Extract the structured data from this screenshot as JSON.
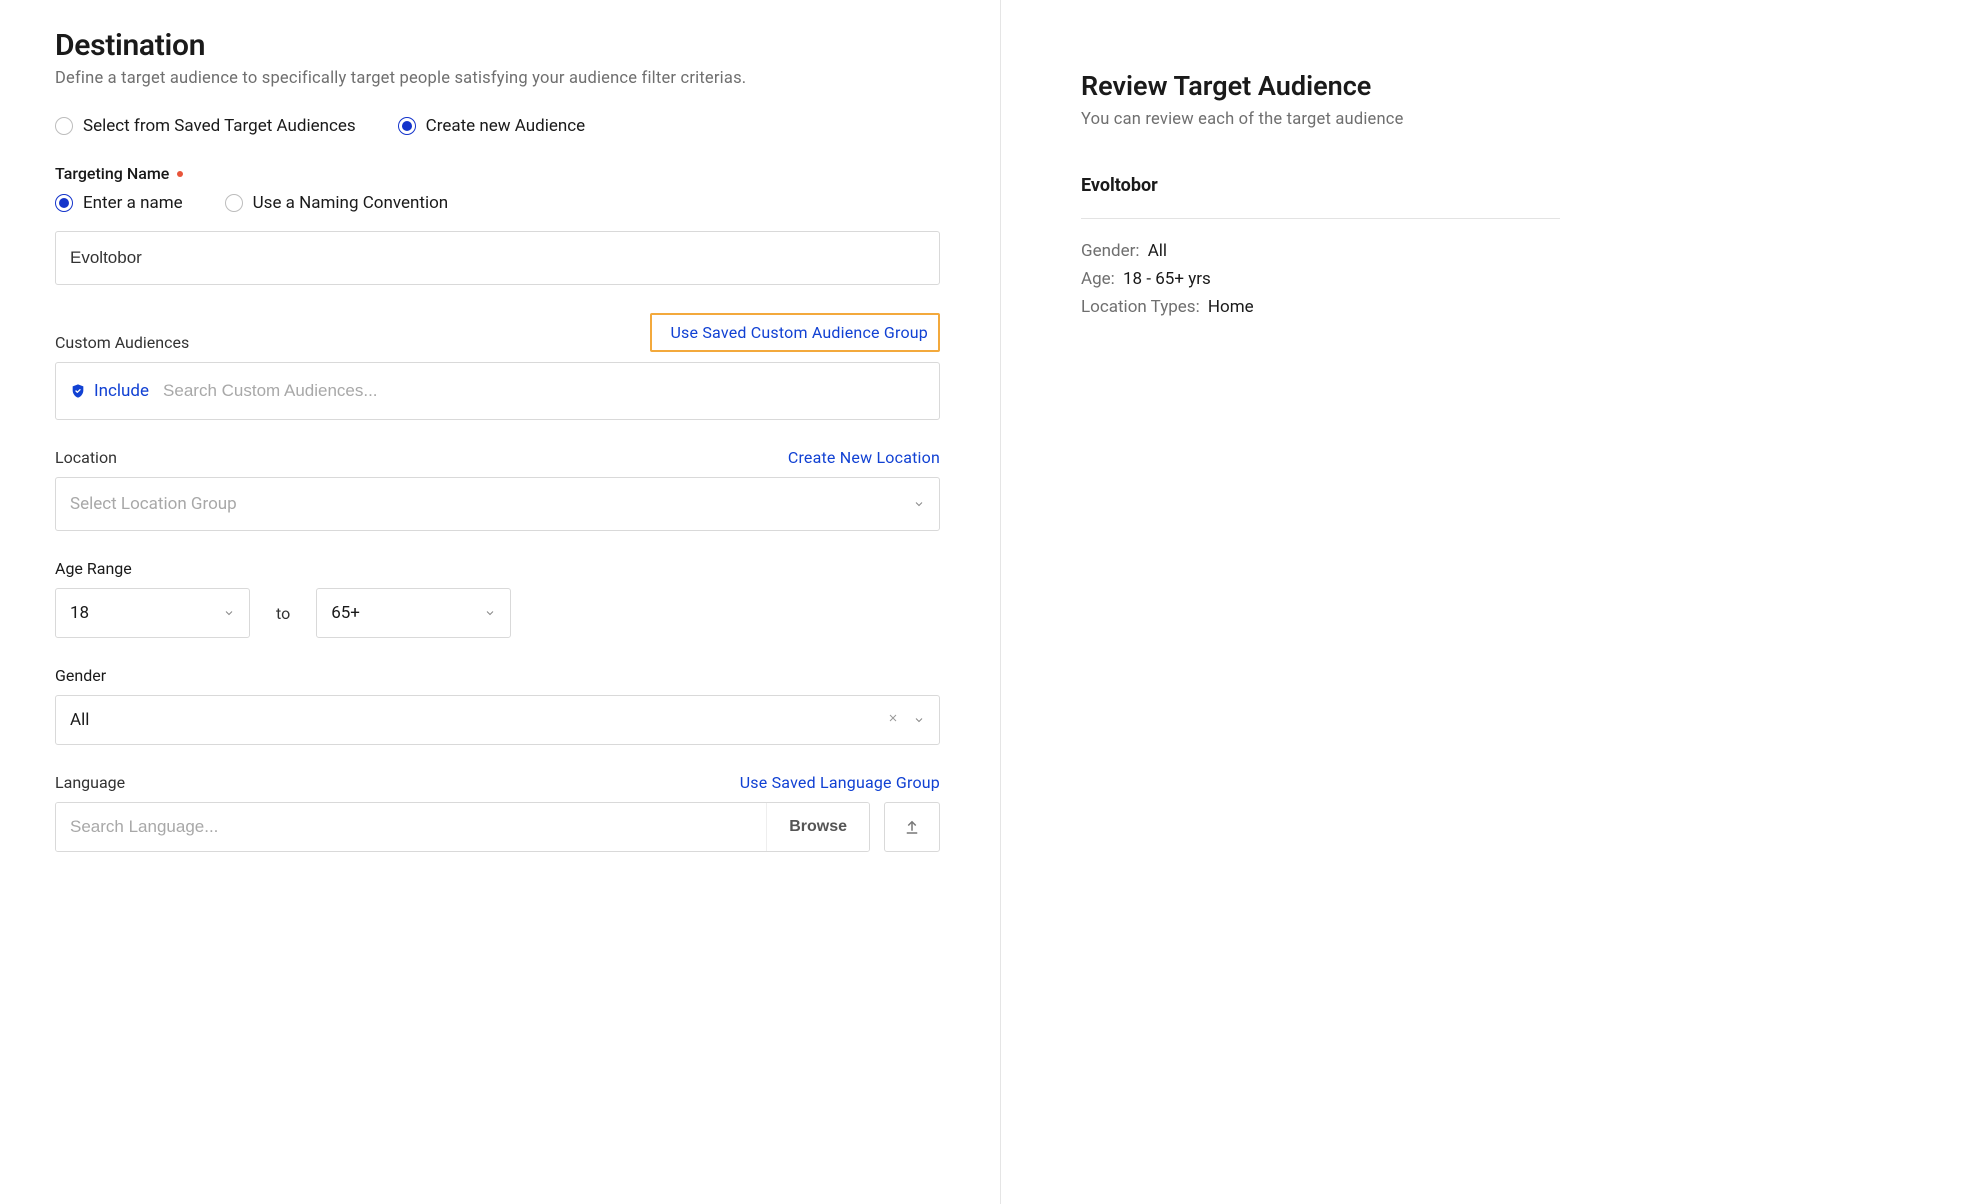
{
  "page": {
    "title": "Destination",
    "subtitle": "Define a target audience to specifically target people satisfying your audience filter criterias."
  },
  "audienceSource": {
    "saved_label": "Select from Saved Target Audiences",
    "create_label": "Create new Audience"
  },
  "targetingName": {
    "label": "Targeting Name",
    "enter_label": "Enter a name",
    "convention_label": "Use a Naming Convention",
    "value": "Evoltobor"
  },
  "customAudiences": {
    "label": "Custom Audiences",
    "use_saved_link": "Use Saved Custom Audience Group",
    "include_label": "Include",
    "search_placeholder": "Search Custom Audiences..."
  },
  "location": {
    "label": "Location",
    "create_link": "Create New Location",
    "placeholder": "Select Location Group"
  },
  "ageRange": {
    "label": "Age Range",
    "from": "18",
    "to_label": "to",
    "to": "65+"
  },
  "gender": {
    "label": "Gender",
    "value": "All"
  },
  "language": {
    "label": "Language",
    "use_saved_link": "Use Saved Language Group",
    "search_placeholder": "Search Language...",
    "browse_label": "Browse"
  },
  "review": {
    "title": "Review Target Audience",
    "subtitle": "You can review each of the target audience",
    "name": "Evoltobor",
    "gender_label": "Gender:",
    "gender_value": "All",
    "age_label": "Age:",
    "age_value": "18 - 65+ yrs",
    "loc_label": "Location Types:",
    "loc_value": "Home"
  }
}
